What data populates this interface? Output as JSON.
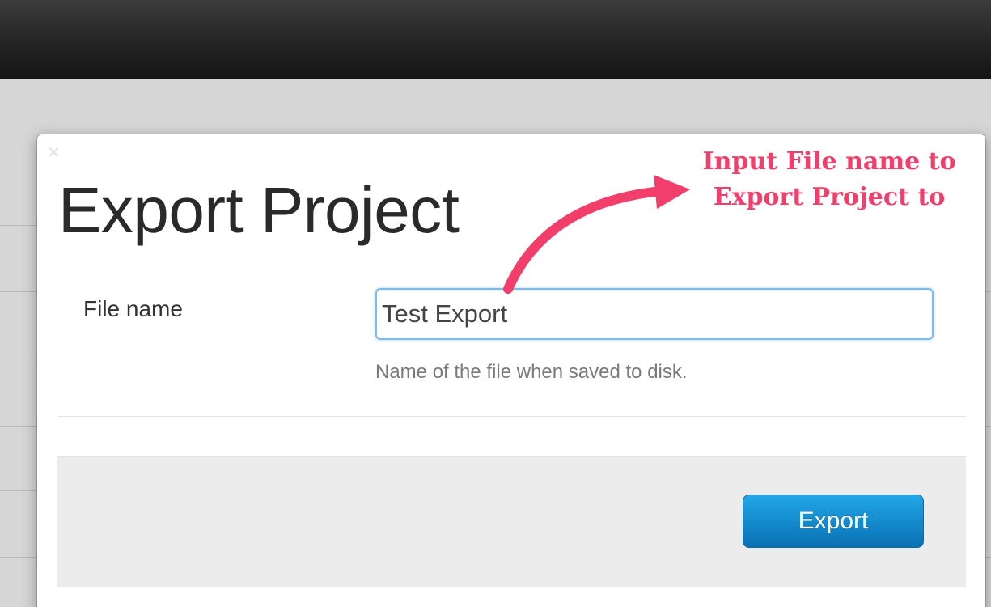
{
  "dialog": {
    "title": "Export Project",
    "close_icon": "close-icon",
    "file_name_label": "File name",
    "file_name_value": "Test Export",
    "file_name_help": "Name of the file when saved to disk.",
    "export_button_label": "Export"
  },
  "annotation": {
    "text": "Input File name to\nExport Project to",
    "color": "#f23e6a",
    "arrow_icon": "curved-arrow-icon"
  },
  "colors": {
    "topbar": "#1f1f1f",
    "backdrop": "#d6d6d6",
    "input_focus_border": "#7fbbe8",
    "primary_button": "#1389cc",
    "footer_panel": "#ececec"
  }
}
